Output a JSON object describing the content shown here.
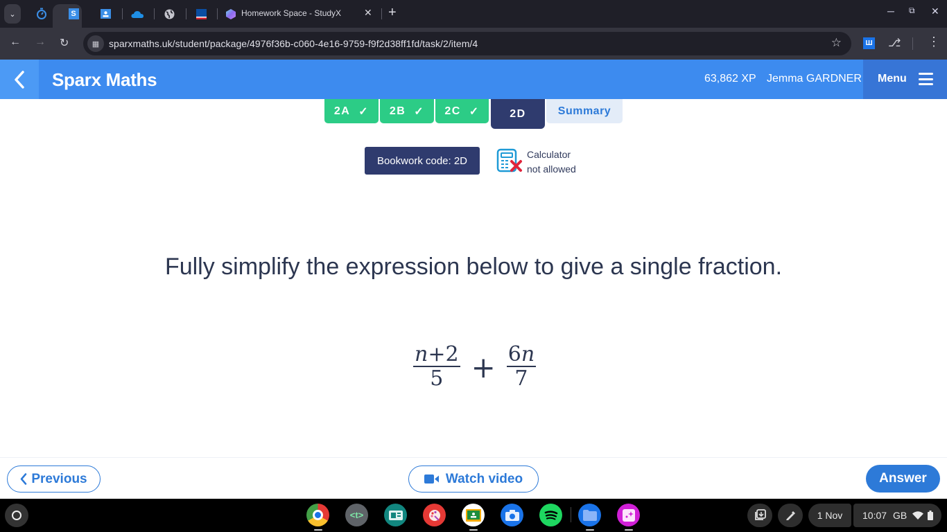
{
  "browser": {
    "tab_dropdown_icon": "chevron-down-icon",
    "pinned_tabs": [
      {
        "name": "timer-icon"
      },
      {
        "name": "sparx-s-icon",
        "active": true
      },
      {
        "name": "google-classroom-icon"
      },
      {
        "name": "onedrive-icon"
      },
      {
        "name": "globe-icon"
      },
      {
        "name": "flag-icon"
      }
    ],
    "active_tab_title": "Homework Space - StudyX",
    "new_tab": "+",
    "url": "sparxmaths.uk/student/package/4976f36b-c060-4e16-9759-f9f2d38ff1fd/task/2/item/4"
  },
  "header": {
    "brand": "Sparx Maths",
    "xp": "63,862 XP",
    "username": "Jemma GARDNER",
    "menu_label": "Menu"
  },
  "task_tabs": [
    {
      "label": "2A",
      "status": "done"
    },
    {
      "label": "2B",
      "status": "done"
    },
    {
      "label": "2C",
      "status": "done"
    },
    {
      "label": "2D",
      "status": "current"
    },
    {
      "label": "Summary",
      "status": "summary"
    }
  ],
  "bookwork": "Bookwork code: 2D",
  "calculator": {
    "line1": "Calculator",
    "line2": "not allowed"
  },
  "question": {
    "text": "Fully simplify the expression below to give a single fraction.",
    "expression": {
      "term1": {
        "numerator_var": "n",
        "numerator_rest": "+2",
        "denominator": "5"
      },
      "operator": "+",
      "term2": {
        "numerator_coef": "6",
        "numerator_var": "n",
        "denominator": "7"
      }
    }
  },
  "footer": {
    "previous": "Previous",
    "watch_video": "Watch video",
    "answer": "Answer"
  },
  "colors": {
    "header_blue": "#3d8bef",
    "done_green": "#2ccc86",
    "navy": "#2f3b6e",
    "action_blue": "#2d7ad8"
  },
  "shelf": {
    "apps": [
      "chrome",
      "text-editor",
      "news-app",
      "paint",
      "google-classroom",
      "camera",
      "spotify",
      "files",
      "gallery"
    ],
    "date": "1 Nov",
    "time": "10:07",
    "region": "GB"
  }
}
